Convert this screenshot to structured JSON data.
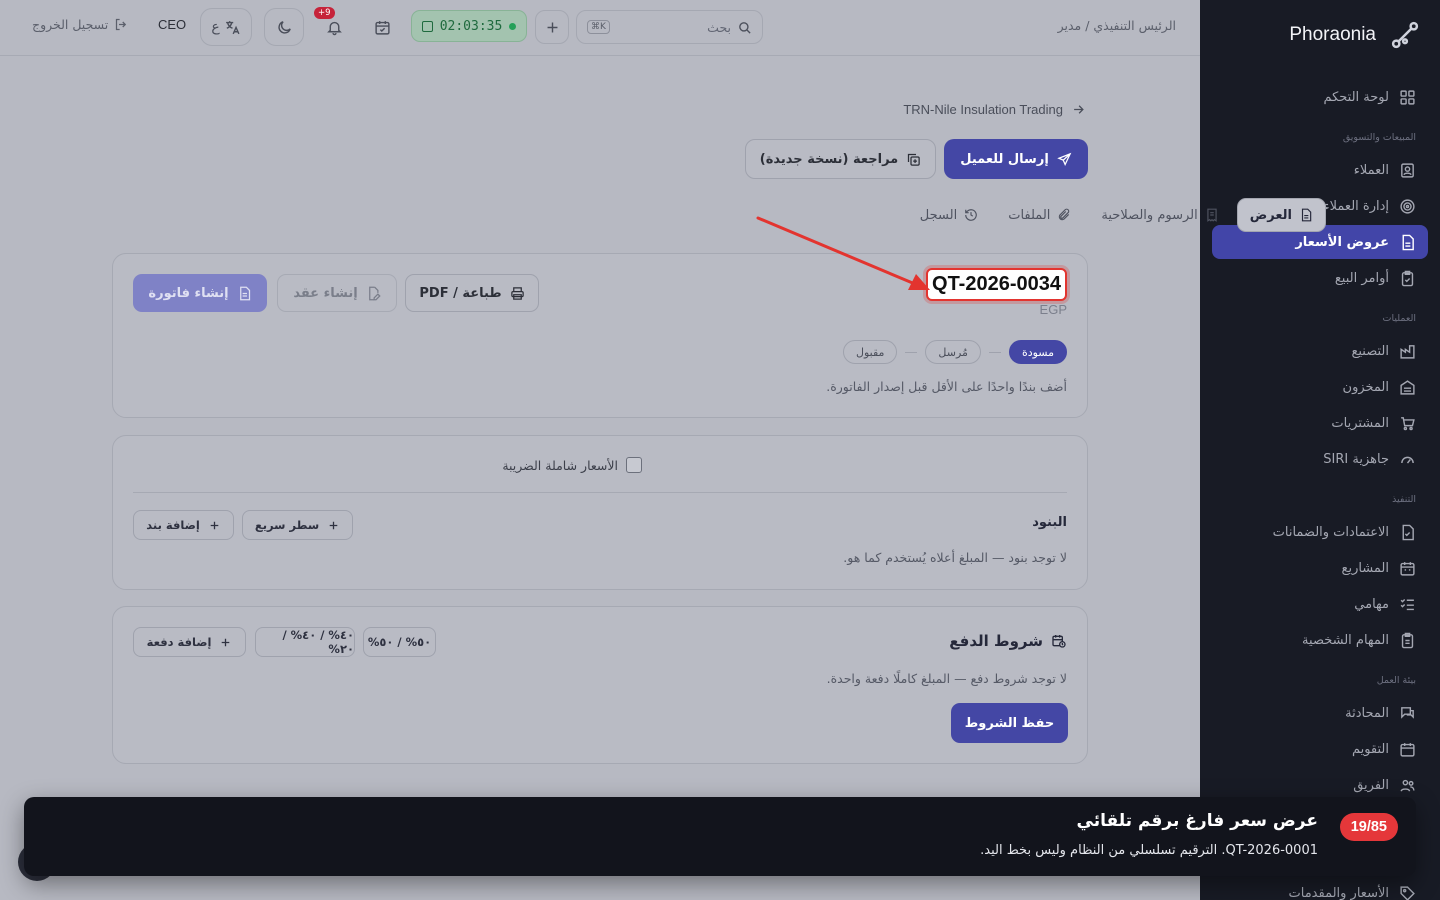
{
  "app": {
    "brand": "Phoraonia"
  },
  "topbar": {
    "role": "الرئيس التنفيذي / مدير",
    "search_placeholder": "بحث",
    "search_kbd": "K⌘",
    "timer": "02:03:35",
    "notif_count": "+9",
    "lang_label": "ع",
    "user": "CEO",
    "logout": "تسجيل الخروج"
  },
  "sidebar": {
    "items": [
      {
        "label": "لوحة التحكم",
        "icon": "dashboard-icon"
      },
      {
        "label": "المبيعات والتسويق",
        "section": true
      },
      {
        "label": "العملاء",
        "icon": "contacts-icon"
      },
      {
        "label": "إدارة العملاء المحتملين",
        "icon": "target-icon"
      },
      {
        "label": "عروض الأسعار",
        "icon": "document-icon",
        "active": true
      },
      {
        "label": "أوامر البيع",
        "icon": "clipboard-check-icon"
      },
      {
        "label": "العمليات",
        "section": true
      },
      {
        "label": "التصنيع",
        "icon": "factory-icon"
      },
      {
        "label": "المخزون",
        "icon": "warehouse-icon"
      },
      {
        "label": "المشتريات",
        "icon": "cart-icon"
      },
      {
        "label": "جاهزية SIRI",
        "icon": "gauge-icon"
      },
      {
        "label": "التنفيذ",
        "section": true
      },
      {
        "label": "الاعتمادات والضمانات",
        "icon": "file-check-icon"
      },
      {
        "label": "المشاريع",
        "icon": "calendar-grid-icon"
      },
      {
        "label": "مهامي",
        "icon": "list-check-icon"
      },
      {
        "label": "المهام الشخصية",
        "icon": "clipboard-icon"
      },
      {
        "label": "بيئة العمل",
        "section": true
      },
      {
        "label": "المحادثة",
        "icon": "chat-icon"
      },
      {
        "label": "التقويم",
        "icon": "calendar-icon"
      },
      {
        "label": "الفريق",
        "icon": "team-icon"
      },
      {
        "label": "الأسعار والمقدمات",
        "icon": "tag-icon"
      }
    ]
  },
  "main": {
    "breadcrumb": "TRN-Nile Insulation Trading",
    "send_button": "إرسال للعميل",
    "revision_button": "مراجعة (نسخة جديدة)",
    "tabs": [
      {
        "label": "العرض",
        "active": true
      },
      {
        "label": "الرسوم والصلاحية"
      },
      {
        "label": "الملفات"
      },
      {
        "label": "السجل"
      }
    ],
    "quote": {
      "number": "QT-2026-0034",
      "currency": "EGP",
      "statuses": [
        "مسودة",
        "مُرسل",
        "مقبول"
      ],
      "hint": "أضف بندًا واحدًا على الأقل قبل إصدار الفاتورة.",
      "print_button": "طباعة / PDF",
      "contract_button": "إنشاء عقد",
      "invoice_button": "إنشاء فاتورة"
    },
    "items_card": {
      "tax_label": "الأسعار شاملة الضريبة",
      "title": "البنود",
      "quick_line": "سطر سريع",
      "add_item": "إضافة بند",
      "empty": "لا توجد بنود — المبلغ أعلاه يُستخدم كما هو."
    },
    "payment_card": {
      "title": "شروط الدفع",
      "presets": [
        "٥٠% / ٥٠%",
        "٤٠% / ٤٠% / ٢٠%"
      ],
      "add_payment": "إضافة دفعة",
      "empty": "لا توجد شروط دفع — المبلغ كاملًا دفعة واحدة.",
      "save": "حفظ الشروط"
    }
  },
  "toast": {
    "badge": "19/85",
    "title": "عرض سعر فارغ برقم تلقائي",
    "subtitle": "QT-2026-0001. الترقيم تسلسلي من النظام وليس بخط اليد."
  },
  "colors": {
    "accent": "#4447a5",
    "sidebar_bg": "#181b25",
    "highlight": "#e3342f"
  }
}
